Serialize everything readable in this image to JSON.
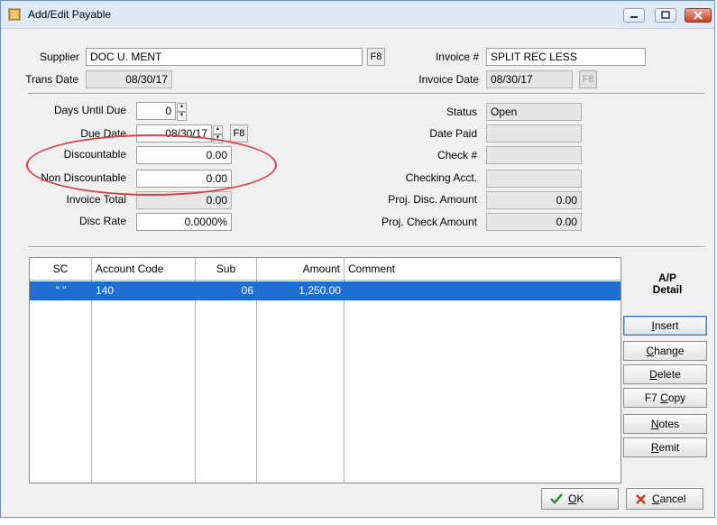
{
  "window": {
    "title": "Add/Edit Payable",
    "icon": "ledger-app-icon",
    "controls": [
      "minimize-icon",
      "maximize-icon",
      "close-icon"
    ]
  },
  "header": {
    "supplier_label": "Supplier",
    "supplier_value": "DOC U. MENT",
    "supplier_lookup": "F8",
    "trans_date_label": "Trans Date",
    "trans_date_value": "08/30/17",
    "invoice_label": "Invoice #",
    "invoice_value": "SPLIT REC LESS",
    "invoice_date_label": "Invoice Date",
    "invoice_date_value": "08/30/17",
    "invoice_date_lookup": "F8"
  },
  "details_left": {
    "days_until_due_label": "Days Until Due",
    "days_until_due_value": "0",
    "due_date_label": "Due Date",
    "due_date_value": "08/30/17",
    "due_date_lookup": "F8",
    "discountable_label": "Discountable",
    "discountable_value": "0.00",
    "non_discountable_label": "Non Discountable",
    "non_discountable_value": "0.00",
    "invoice_total_label": "Invoice Total",
    "invoice_total_value": "0.00",
    "disc_rate_label": "Disc Rate",
    "disc_rate_value": "0.0000%"
  },
  "details_right": {
    "status_label": "Status",
    "status_value": "Open",
    "date_paid_label": "Date Paid",
    "date_paid_value": "",
    "check_label": "Check #",
    "check_value": "",
    "checking_acct_label": "Checking Acct.",
    "checking_acct_value": "",
    "proj_disc_amount_label": "Proj. Disc. Amount",
    "proj_disc_amount_value": "0.00",
    "proj_check_amount_label": "Proj. Check Amount",
    "proj_check_amount_value": "0.00"
  },
  "grid": {
    "columns": [
      "SC",
      "Account Code",
      "Sub",
      "Amount",
      "Comment"
    ],
    "rows": [
      {
        "sc": "\" \"",
        "account_code": "140",
        "sub": "06",
        "amount": "1,250.00",
        "comment": ""
      }
    ]
  },
  "side_panel": {
    "title_line1": "A/P",
    "title_line2": "Detail",
    "insert": {
      "pre": "",
      "key": "I",
      "post": "nsert"
    },
    "change": {
      "pre": "",
      "key": "C",
      "post": "hange"
    },
    "delete": {
      "pre": "",
      "key": "D",
      "post": "elete"
    },
    "copy": {
      "pre": "F7 ",
      "key": "C",
      "post": "opy"
    },
    "notes": {
      "pre": "",
      "key": "N",
      "post": "otes"
    },
    "remit": {
      "pre": "",
      "key": "R",
      "post": "emit"
    }
  },
  "footer": {
    "ok": {
      "key": "O",
      "post": "K"
    },
    "cancel": {
      "key": "C",
      "post": "ancel"
    }
  },
  "colors": {
    "selection": "#1e6fd1",
    "highlight_oval": "#d64546",
    "ok_check": "#2e8b2e",
    "cancel_x": "#c0392b"
  }
}
